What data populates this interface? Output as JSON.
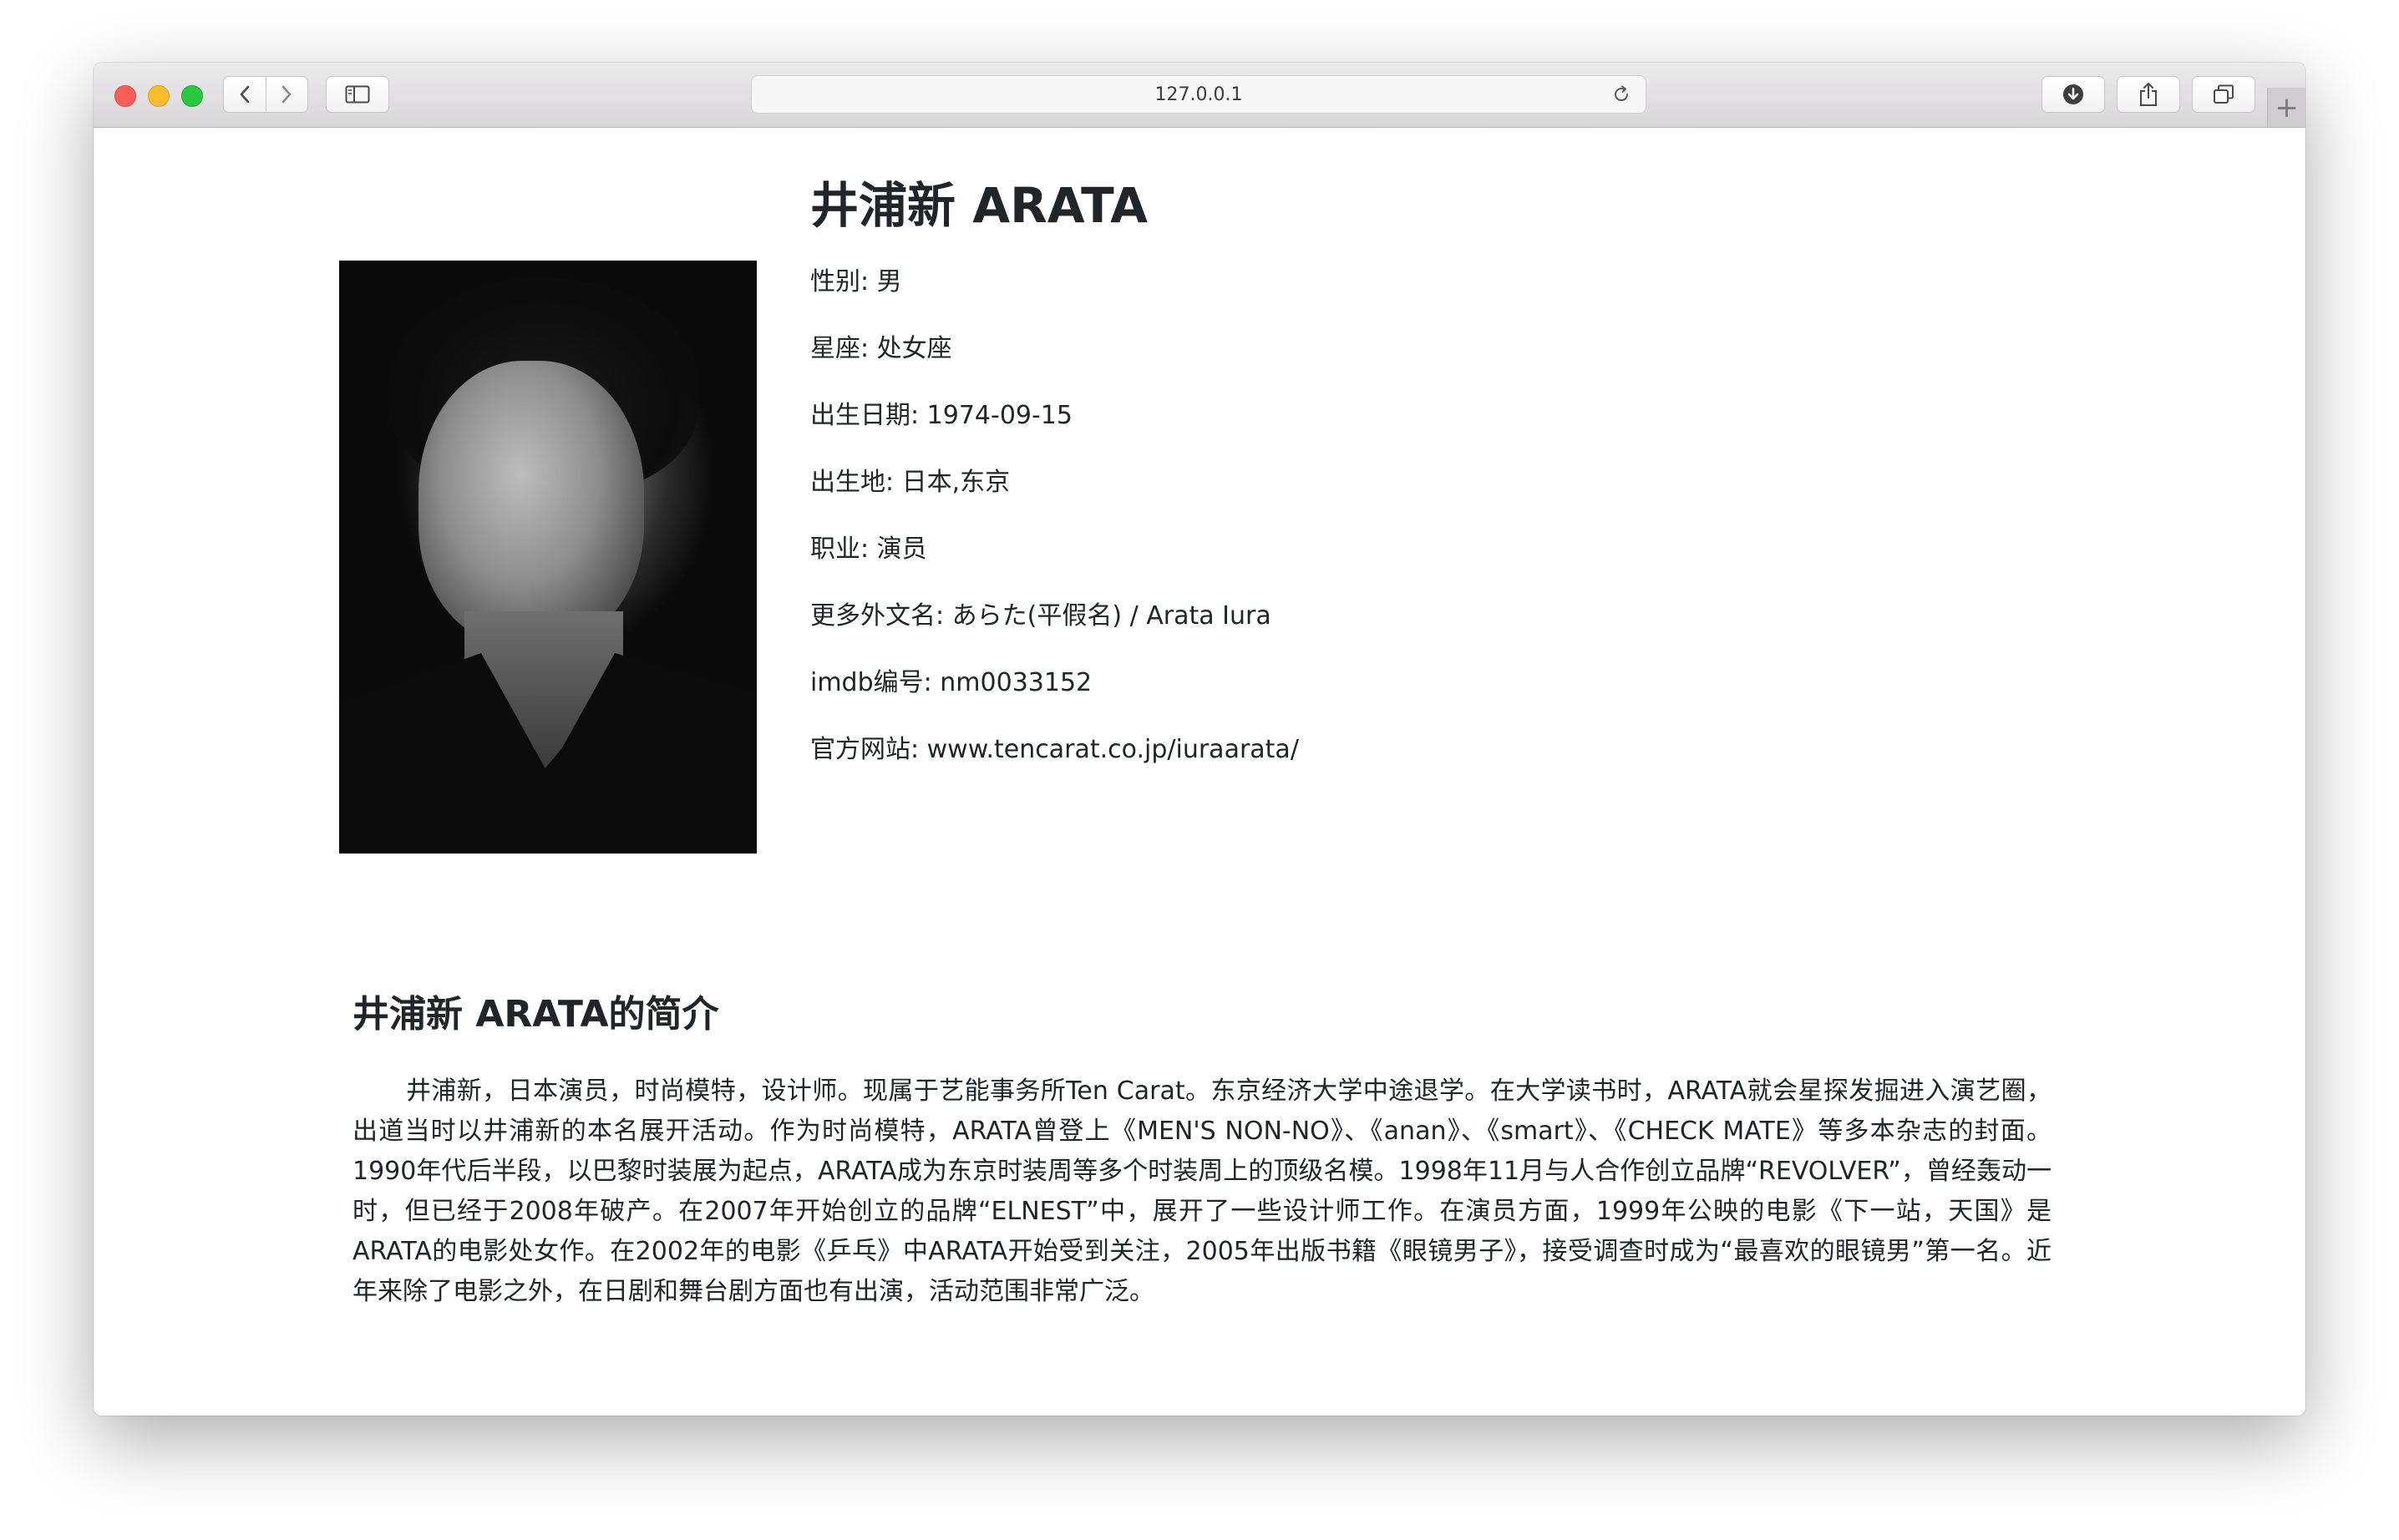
{
  "browser": {
    "url": "127.0.0.1",
    "new_tab_label": "+"
  },
  "profile": {
    "name": "井浦新 ARATA",
    "fields": [
      "性别: 男",
      "星座: 处女座",
      "出生日期: 1974-09-15",
      "出生地: 日本,东京",
      "职业: 演员",
      "更多外文名: あらた(平假名) / Arata Iura",
      "imdb编号: nm0033152",
      "官方网站: www.tencarat.co.jp/iuraarata/"
    ]
  },
  "intro": {
    "title": "井浦新 ARATA的简介",
    "text": "井浦新，日本演员，时尚模特，设计师。现属于艺能事务所Ten Carat。东京经济大学中途退学。在大学读书时，ARATA就会星探发掘进入演艺圈，出道当时以井浦新的本名展开活动。作为时尚模特，ARATA曾登上《MEN'S NON-NO》、《anan》、《smart》、《CHECK MATE》等多本杂志的封面。1990年代后半段，以巴黎时装展为起点，ARATA成为东京时装周等多个时装周上的顶级名模。1998年11月与人合作创立品牌“REVOLVER”，曾经轰动一时，但已经于2008年破产。在2007年开始创立的品牌“ELNEST”中，展开了一些设计师工作。在演员方面，1999年公映的电影《下一站，天国》是ARATA的电影处女作。在2002年的电影《乒乓》中ARATA开始受到关注，2005年出版书籍《眼镜男子》，接受调查时成为“最喜欢的眼镜男”第一名。近年来除了电影之外，在日剧和舞台剧方面也有出演，活动范围非常广泛。"
  }
}
